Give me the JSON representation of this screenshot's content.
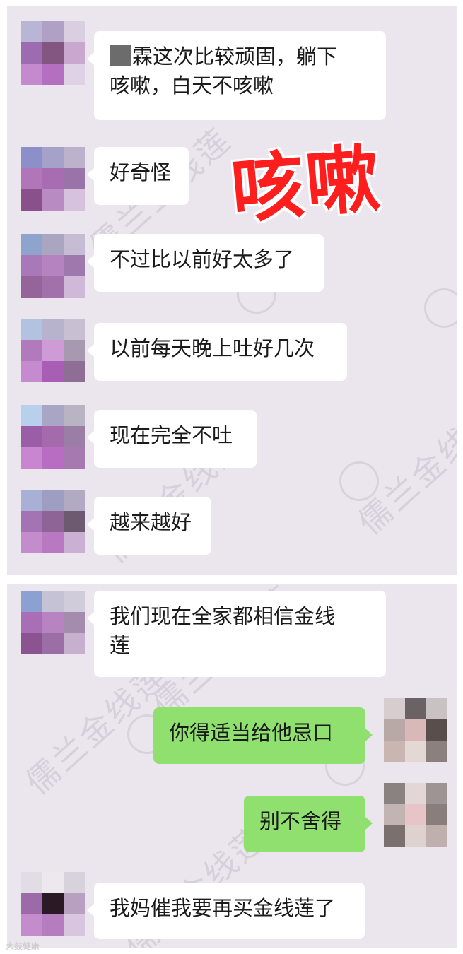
{
  "overlay": {
    "stamp_text": "咳嗽"
  },
  "watermark": {
    "text": "儒兰金线莲"
  },
  "source_credit": "大鼓健康",
  "colors": {
    "panel_bg": "#ebe6ee",
    "incoming_bubble": "#ffffff",
    "outgoing_bubble": "#8fe06e",
    "stamp": "#ff1e1e"
  },
  "messages": [
    {
      "side": "left",
      "lines": [
        "霖这次比较顽固，躺下",
        "咳嗽，白天不咳嗽"
      ],
      "has_censor_block": true
    },
    {
      "side": "left",
      "lines": [
        "好奇怪"
      ]
    },
    {
      "side": "left",
      "lines": [
        "不过比以前好太多了"
      ]
    },
    {
      "side": "left",
      "lines": [
        "以前每天晚上吐好几次"
      ]
    },
    {
      "side": "left",
      "lines": [
        "现在完全不吐"
      ]
    },
    {
      "side": "left",
      "lines": [
        "越来越好"
      ]
    },
    {
      "side": "left",
      "lines": [
        "我们现在全家都相信金线",
        "莲"
      ]
    },
    {
      "side": "right",
      "lines": [
        "你得适当给他忌口"
      ]
    },
    {
      "side": "right",
      "lines": [
        "别不舍得"
      ]
    },
    {
      "side": "left",
      "lines": [
        "我妈催我要再买金线莲了"
      ]
    }
  ]
}
